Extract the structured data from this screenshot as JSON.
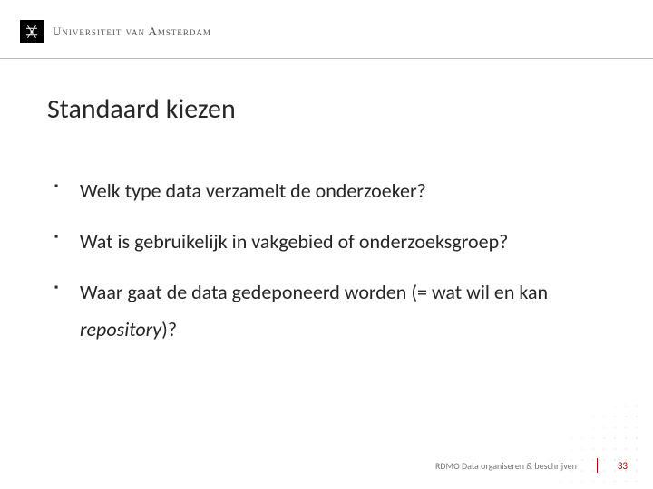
{
  "header": {
    "university_name": "Universiteit van Amsterdam"
  },
  "title": "Standaard kiezen",
  "bullets": [
    {
      "text": "Welk type data verzamelt de onderzoeker?"
    },
    {
      "text_pre": "Wat is gebruikelijk in vakgebied of onderzoeksgroep?"
    },
    {
      "text_pre": "Waar gaat de data gedeponeerd worden (= wat wil en kan ",
      "italic": "repository",
      "text_post": ")?"
    }
  ],
  "footer": {
    "label": "RDMO Data organiseren & beschrijven",
    "page_number": "33"
  }
}
